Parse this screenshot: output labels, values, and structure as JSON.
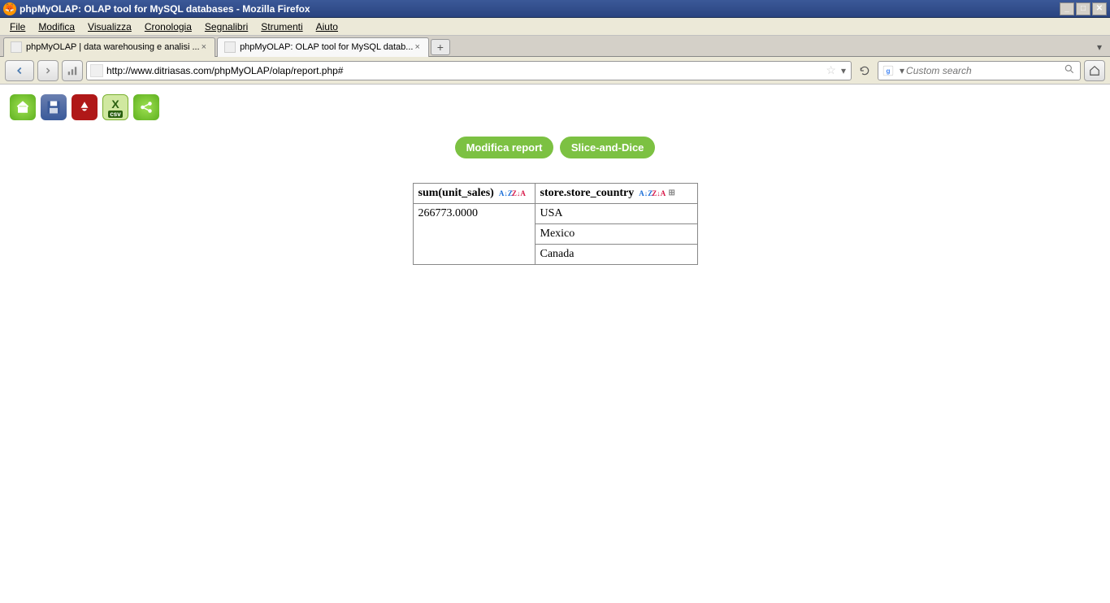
{
  "window": {
    "title": "phpMyOLAP: OLAP tool for MySQL databases - Mozilla Firefox"
  },
  "menu": {
    "file": "File",
    "edit": "Modifica",
    "view": "Visualizza",
    "history": "Cronologia",
    "bookmarks": "Segnalibri",
    "tools": "Strumenti",
    "help": "Aiuto"
  },
  "tabs": [
    {
      "label": "phpMyOLAP | data warehousing e analisi ..."
    },
    {
      "label": "phpMyOLAP: OLAP tool for MySQL datab..."
    }
  ],
  "nav": {
    "url": "http://www.ditriasas.com/phpMyOLAP/olap/report.php#",
    "search_placeholder": "Custom search"
  },
  "toolbar": {
    "home": "home",
    "save": "save",
    "pdf": "PDF",
    "csv_x": "X",
    "csv_label": "csv",
    "share": "share"
  },
  "actions": {
    "modify": "Modifica report",
    "slice": "Slice-and-Dice"
  },
  "table": {
    "headers": {
      "measure": "sum(unit_sales)",
      "dimension": "store.store_country"
    },
    "sort": {
      "az": "A↓Z",
      "za": "Z↓A"
    },
    "rows": [
      {
        "measure": "266773.0000",
        "dimension": "USA"
      },
      {
        "measure": "",
        "dimension": "Mexico"
      },
      {
        "measure": "",
        "dimension": "Canada"
      }
    ]
  }
}
